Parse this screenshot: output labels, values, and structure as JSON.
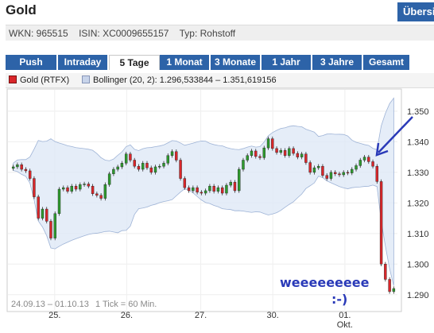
{
  "header": {
    "title": "Gold",
    "right_tab": "Übersicht"
  },
  "info": {
    "wkn": "WKN: 965515",
    "isin": "ISIN: XC0009655157",
    "typ": "Typ: Rohstoff"
  },
  "tabs": [
    {
      "label": "Push",
      "active": false
    },
    {
      "label": "Intraday",
      "active": false
    },
    {
      "label": "5 Tage",
      "active": true
    },
    {
      "label": "1 Monat",
      "active": false
    },
    {
      "label": "3 Monate",
      "active": false
    },
    {
      "label": "1 Jahr",
      "active": false
    },
    {
      "label": "3 Jahre",
      "active": false
    },
    {
      "label": "Gesamt",
      "active": false
    }
  ],
  "legend": {
    "gold": "Gold (RTFX)",
    "bollinger": "Bollinger (20, 2): 1.296,533844 – 1.351,619156",
    "gold_color": "#d9262a",
    "bollinger_color": "#c8d4ea"
  },
  "annotation": {
    "line1": "weeeeeeeee",
    "line2": ":-)",
    "color": "#2a3ab8"
  },
  "chart_data": {
    "type": "candlestick",
    "range_label": "24.09.13 – 01.10.13",
    "tick_label": "1 Tick = 60 Min.",
    "ylim": [
      1.285,
      1.357
    ],
    "y_ticks": [
      "1.290",
      "1.300",
      "1.310",
      "1.320",
      "1.330",
      "1.340",
      "1.350"
    ],
    "x_labels": [
      {
        "label": "25.",
        "t": 0.12
      },
      {
        "label": "26.",
        "t": 0.305
      },
      {
        "label": "27.",
        "t": 0.495
      },
      {
        "label": "30.",
        "t": 0.68
      },
      {
        "label": "01.",
        "t": 0.865
      },
      {
        "label": "Okt.",
        "t": 0.865,
        "second_line": true
      }
    ],
    "close": [
      1.3318,
      1.3325,
      1.331,
      1.3305,
      1.328,
      1.322,
      1.315,
      1.318,
      1.314,
      1.3085,
      1.3165,
      1.3245,
      1.325,
      1.3238,
      1.3255,
      1.3245,
      1.326,
      1.3262,
      1.3255,
      1.323,
      1.3225,
      1.3215,
      1.326,
      1.3295,
      1.331,
      1.3318,
      1.333,
      1.336,
      1.334,
      1.332,
      1.331,
      1.333,
      1.3315,
      1.33,
      1.3318,
      1.332,
      1.333,
      1.3355,
      1.3368,
      1.334,
      1.328,
      1.325,
      1.324,
      1.325,
      1.3235,
      1.3232,
      1.324,
      1.3255,
      1.3238,
      1.325,
      1.3232,
      1.3258,
      1.3268,
      1.324,
      1.331,
      1.334,
      1.3355,
      1.337,
      1.3352,
      1.3348,
      1.338,
      1.341,
      1.3378,
      1.3365,
      1.3372,
      1.3355,
      1.3378,
      1.3362,
      1.335,
      1.336,
      1.3332,
      1.33,
      1.3315,
      1.332,
      1.329,
      1.328,
      1.33,
      1.3295,
      1.3292,
      1.33,
      1.3298,
      1.331,
      1.3322,
      1.334,
      1.335,
      1.3335,
      1.332,
      1.327,
      1.3,
      1.295,
      1.291,
      1.292
    ]
  }
}
